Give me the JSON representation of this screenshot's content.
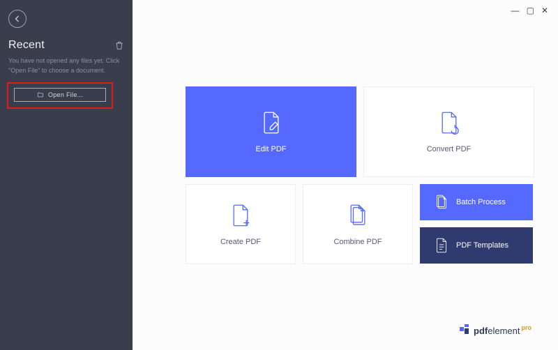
{
  "sidebar": {
    "title": "Recent",
    "hint": "You have not opened any files yet. Click \"Open File\" to choose a document.",
    "open_label": "Open File..."
  },
  "cards": {
    "edit": "Edit PDF",
    "convert": "Convert PDF",
    "create": "Create PDF",
    "combine": "Combine PDF",
    "batch": "Batch Process",
    "templates": "PDF Templates"
  },
  "brand": {
    "part1": "pdf",
    "part2": "element",
    "suffix": "pro"
  },
  "window": {
    "min": "—",
    "max": "▢",
    "close": "✕"
  }
}
